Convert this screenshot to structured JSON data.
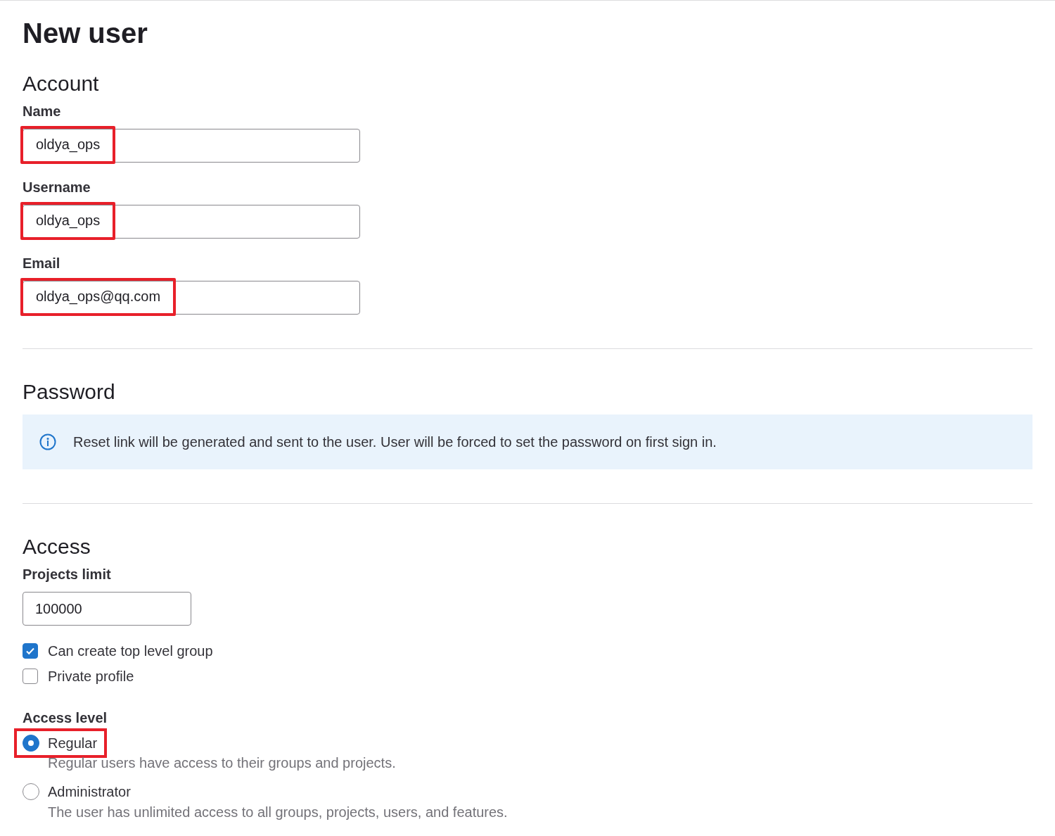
{
  "title": "New user",
  "account": {
    "heading": "Account",
    "fields": [
      {
        "label": "Name",
        "value": "oldya_ops",
        "highlighted": true
      },
      {
        "label": "Username",
        "value": "oldya_ops",
        "highlighted": true
      },
      {
        "label": "Email",
        "value": "oldya_ops@qq.com",
        "highlighted": true
      }
    ]
  },
  "password": {
    "heading": "Password",
    "alert": "Reset link will be generated and sent to the user. User will be forced to set the password on first sign in."
  },
  "access": {
    "heading": "Access",
    "projects_limit": {
      "label": "Projects limit",
      "value": "100000"
    },
    "checkboxes": [
      {
        "label": "Can create top level group",
        "checked": true
      },
      {
        "label": "Private profile",
        "checked": false
      }
    ],
    "access_level": {
      "label": "Access level",
      "options": [
        {
          "label": "Regular",
          "description": "Regular users have access to their groups and projects.",
          "selected": true,
          "highlighted": true
        },
        {
          "label": "Administrator",
          "description": "The user has unlimited access to all groups, projects, users, and features.",
          "selected": false,
          "highlighted": false
        }
      ]
    }
  }
}
